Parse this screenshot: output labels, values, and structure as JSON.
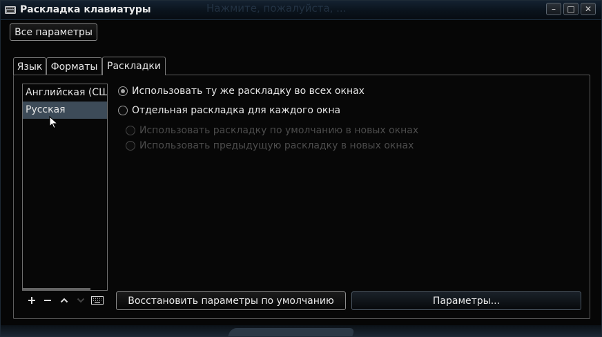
{
  "window": {
    "title": "Раскладка клавиатуры",
    "background_title": "Нажмите, пожалуйста, ...",
    "controls": {
      "minimize": "–",
      "maximize": "□",
      "close": "✕"
    }
  },
  "all_settings_button": "Все параметры",
  "tabs": [
    {
      "label": "Язык",
      "active": false
    },
    {
      "label": "Форматы",
      "active": false
    },
    {
      "label": "Раскладки",
      "active": true
    }
  ],
  "layouts": {
    "items": [
      {
        "label": "Английская (США)",
        "selected": false
      },
      {
        "label": "Русская",
        "selected": true
      }
    ],
    "toolbar_icons": [
      "add-icon",
      "remove-icon",
      "move-up-icon",
      "move-down-icon",
      "keyboard-icon"
    ]
  },
  "options": {
    "same_layout": {
      "label": "Использовать ту же раскладку во всех окнах",
      "checked": true,
      "enabled": true
    },
    "separate_layout": {
      "label": "Отдельная раскладка для каждого окна",
      "checked": false,
      "enabled": true
    },
    "default_new": {
      "label": "Использовать раскладку по умолчанию в новых окнах",
      "checked": false,
      "enabled": false
    },
    "previous_new": {
      "label": "Использовать предыдущую раскладку в новых окнах",
      "checked": false,
      "enabled": false
    }
  },
  "buttons": {
    "restore_defaults": "Восстановить параметры по умолчанию",
    "parameters": "Параметры..."
  },
  "colors": {
    "selection": "#3d4b58",
    "window_bg": "#060606",
    "titlebar": "#142231"
  }
}
